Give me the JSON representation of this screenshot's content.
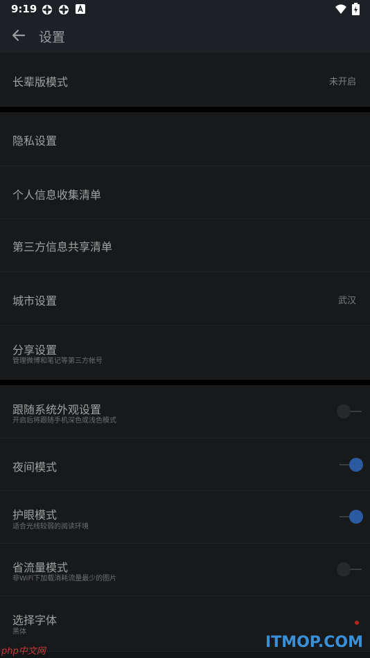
{
  "status_bar": {
    "time": "9:19",
    "icons": [
      "notification-app-icon",
      "notification-app-icon",
      "a-notification-icon",
      "wifi-icon",
      "battery-charging-icon"
    ]
  },
  "app_bar": {
    "back_icon": "arrow-left-icon",
    "title": "设置"
  },
  "settings": {
    "elder_mode": {
      "label": "长辈版模式",
      "value": "未开启"
    },
    "privacy": {
      "label": "隐私设置"
    },
    "personal_info_list": {
      "label": "个人信息收集清单"
    },
    "third_party_list": {
      "label": "第三方信息共享清单"
    },
    "city": {
      "label": "城市设置",
      "value": "武汉"
    },
    "share": {
      "label": "分享设置",
      "sub": "管理微博和笔记等第三方帐号"
    },
    "follow_system": {
      "label": "跟随系统外观设置",
      "sub": "开启后将跟随手机深色或浅色模式",
      "on": false
    },
    "night_mode": {
      "label": "夜间模式",
      "on": true
    },
    "eye_care": {
      "label": "护眼模式",
      "sub": "适合光线较弱的阅读环境",
      "on": true
    },
    "data_saver": {
      "label": "省流量模式",
      "sub": "非WiFi下加载消耗流量最少的图片",
      "on": false
    },
    "font": {
      "label": "选择字体",
      "sub": "黑体"
    }
  },
  "watermarks": {
    "right": "ITMOP.COM",
    "left": "php中文网"
  },
  "colors": {
    "toggle_on": "#2c5aa0",
    "background": "#141516",
    "row": "#18191a",
    "accent_dot": "#b3261e"
  }
}
